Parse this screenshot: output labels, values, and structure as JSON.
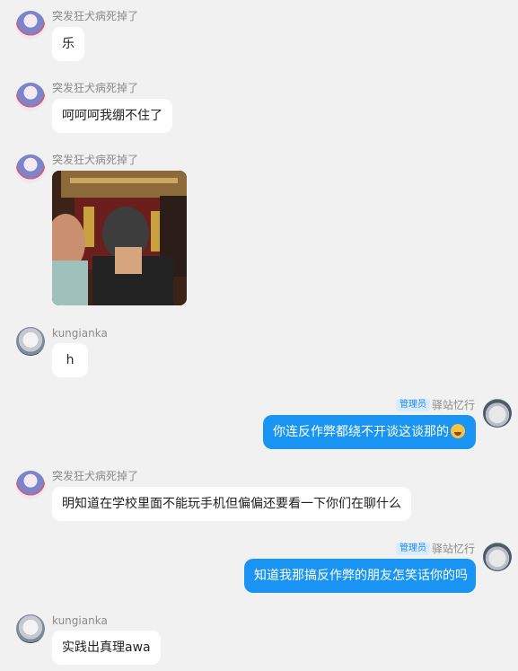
{
  "messages": [
    {
      "sender": "突发狂犬病死掉了",
      "text": "乐"
    },
    {
      "sender": "突发狂犬病死掉了",
      "text": "呵呵呵我绷不住了"
    },
    {
      "sender": "突发狂犬病死掉了",
      "image": "photo"
    },
    {
      "sender": "kungianka",
      "text": "h"
    },
    {
      "sender": "驿站忆行",
      "role": "管理员",
      "text": "你连反作弊都绕不开谈这谈那的",
      "emoji": "laughing-emoji"
    },
    {
      "sender": "突发狂犬病死掉了",
      "text": "明知道在学校里面不能玩手机但偏偏还要看一下你们在聊什么"
    },
    {
      "sender": "驿站忆行",
      "role": "管理员",
      "text": "知道我那搞反作弊的朋友怎笑话你的吗"
    },
    {
      "sender": "kungianka",
      "text": "实践出真理awa"
    }
  ],
  "colors": {
    "background": "#f1f1f1",
    "outgoing_bubble": "#1a94f2",
    "incoming_bubble": "#ffffff",
    "badge_bg": "#d7ecfd",
    "badge_text": "#2a8ae0"
  }
}
